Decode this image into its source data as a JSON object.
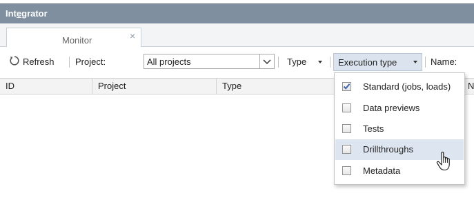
{
  "window": {
    "title_pre": "Int",
    "title_ul": "e",
    "title_post": "grator"
  },
  "tabs": [
    {
      "label": "Monitor",
      "close_glyph": "×"
    }
  ],
  "toolbar": {
    "refresh_label": "Refresh",
    "project_label": "Project:",
    "project_value": "All projects",
    "type_label": "Type",
    "execution_type_label": "Execution type",
    "name_label": "Name:"
  },
  "grid": {
    "columns": [
      "ID",
      "Project",
      "Type"
    ],
    "clipped_column_initial": "N"
  },
  "execution_type_menu": {
    "items": [
      {
        "label": "Standard (jobs, loads)",
        "checked": true
      },
      {
        "label": "Data previews",
        "checked": false
      },
      {
        "label": "Tests",
        "checked": false
      },
      {
        "label": "Drillthroughs",
        "checked": false,
        "hovered": true
      },
      {
        "label": "Metadata",
        "checked": false
      }
    ]
  },
  "icons": {
    "refresh": "refresh-icon",
    "close": "close-icon",
    "dropdown": "chevron-down-icon",
    "checkmark": "checkmark-icon",
    "cursor": "hand-pointer-cursor-icon"
  },
  "colors": {
    "titlebar": "#7f8f9f",
    "menu_hover": "#dde6f0",
    "button_active": "#dbe4ee",
    "check": "#3b64ad"
  }
}
